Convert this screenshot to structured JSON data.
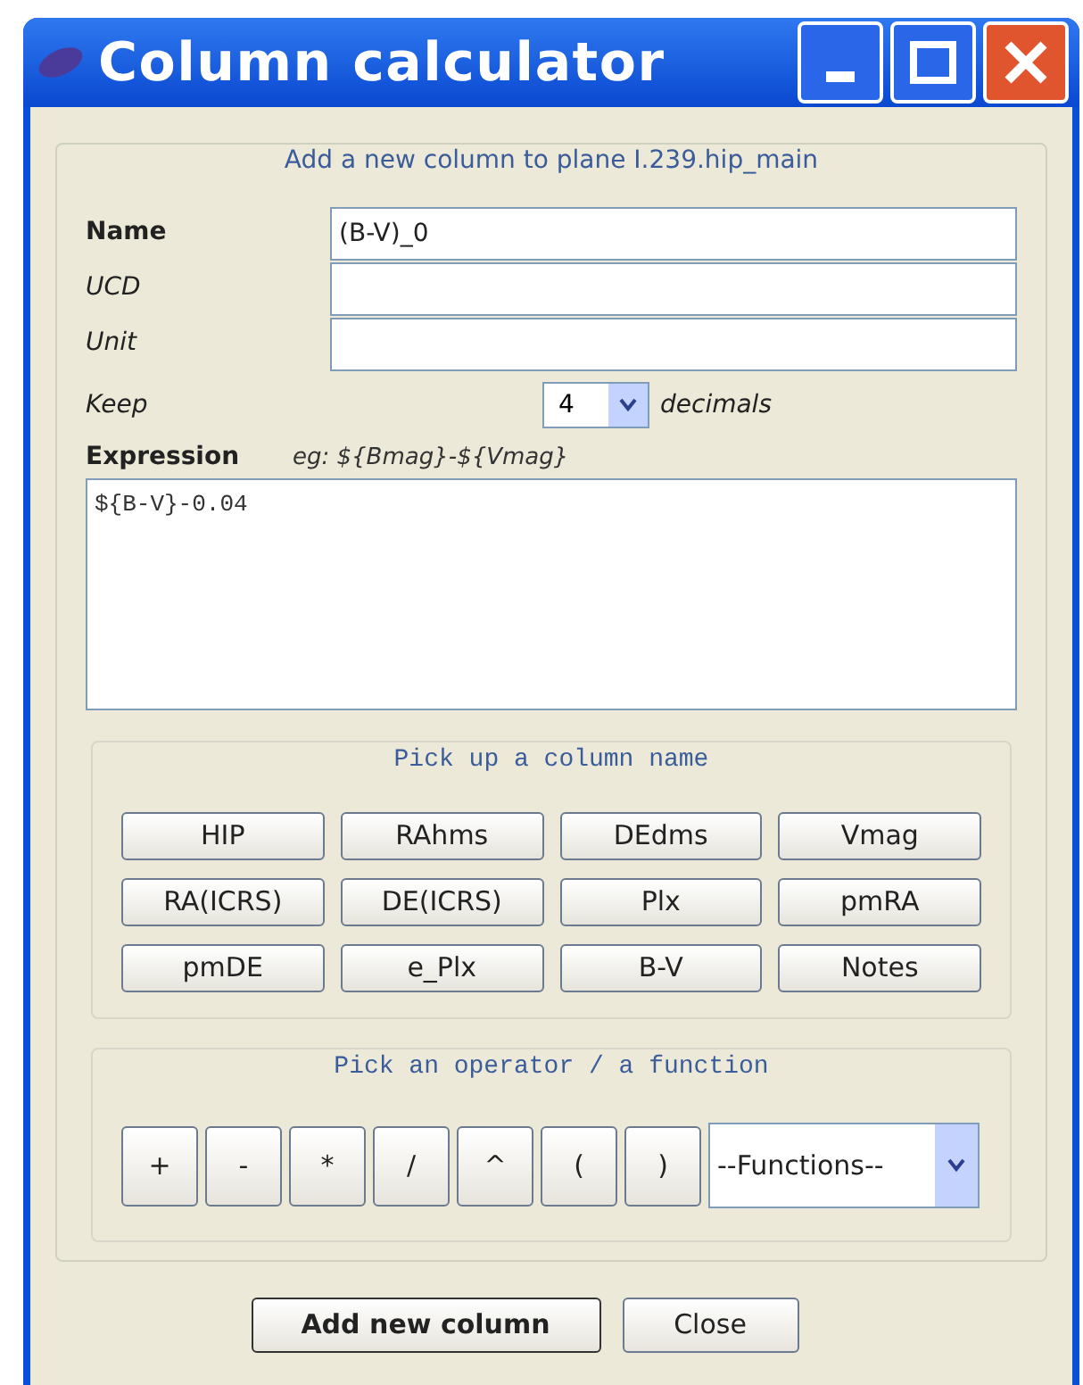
{
  "window": {
    "title": "Column calculator"
  },
  "group_title": "Add a new column to plane I.239.hip_main",
  "fields": [
    {
      "label": "Name",
      "bold": true,
      "value": "(B-V)_0"
    },
    {
      "label": "UCD",
      "bold": false
    },
    {
      "label": "Unit",
      "bold": false
    }
  ],
  "keep": {
    "label": "Keep",
    "value": "4",
    "suffix": "decimals"
  },
  "expression": {
    "label": "Expression",
    "hint": "eg: ${Bmag}-${Vmag}",
    "value": "${B-V}-0.04"
  },
  "columns_group": {
    "title": "Pick up a column name",
    "buttons": [
      "HIP",
      "RAhms",
      "DEdms",
      "Vmag",
      "RA(ICRS)",
      "DE(ICRS)",
      "Plx",
      "pmRA",
      "pmDE",
      "e_Plx",
      "B-V",
      "Notes"
    ]
  },
  "operators_group": {
    "title": "Pick an operator / a function",
    "buttons": [
      "+",
      "-",
      "*",
      "/",
      "^",
      "(",
      ")"
    ],
    "functions": "--Functions--"
  },
  "actions": [
    {
      "label": "Add new column",
      "default": true
    },
    {
      "label": "Close",
      "default": false
    }
  ]
}
